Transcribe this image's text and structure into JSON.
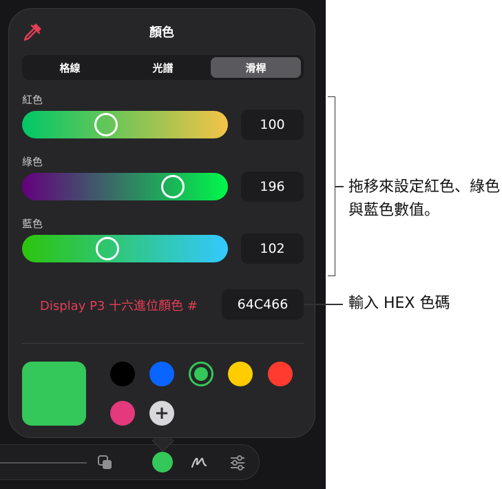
{
  "panel": {
    "title": "顏色"
  },
  "tabs": [
    {
      "label": "格線",
      "active": false
    },
    {
      "label": "光譜",
      "active": false
    },
    {
      "label": "滑桿",
      "active": true
    }
  ],
  "sliders": [
    {
      "label": "紅色",
      "value": "100",
      "fraction": 0.392,
      "gradient": [
        "#00c766",
        "#f3c347"
      ]
    },
    {
      "label": "綠色",
      "value": "196",
      "fraction": 0.769,
      "gradient": [
        "#64007e",
        "#00f84a"
      ]
    },
    {
      "label": "藍色",
      "value": "102",
      "fraction": 0.4,
      "gradient": [
        "#2cc40b",
        "#33c9ff"
      ]
    }
  ],
  "hex": {
    "label": "Display P3 十六進位顏色 #",
    "value": "64C466"
  },
  "current_color": "#34c759",
  "swatches": [
    {
      "name": "black",
      "color": "#000000"
    },
    {
      "name": "blue",
      "color": "#0a64ff"
    },
    {
      "name": "green-selected",
      "color": "#34c759"
    },
    {
      "name": "yellow",
      "color": "#ffcc00"
    },
    {
      "name": "red",
      "color": "#ff3b30"
    },
    {
      "name": "pink",
      "color": "#e4397c"
    }
  ],
  "icons": {
    "eyedropper": "eyedropper-icon",
    "add": "plus-icon",
    "toolbar": [
      "copy-icon",
      "color-well-icon",
      "pen-scribble-icon",
      "sliders-icon"
    ]
  },
  "callouts": {
    "sliders": "拖移來設定紅色、綠色與藍色數值。",
    "hex": "輸入 HEX 色碼"
  }
}
